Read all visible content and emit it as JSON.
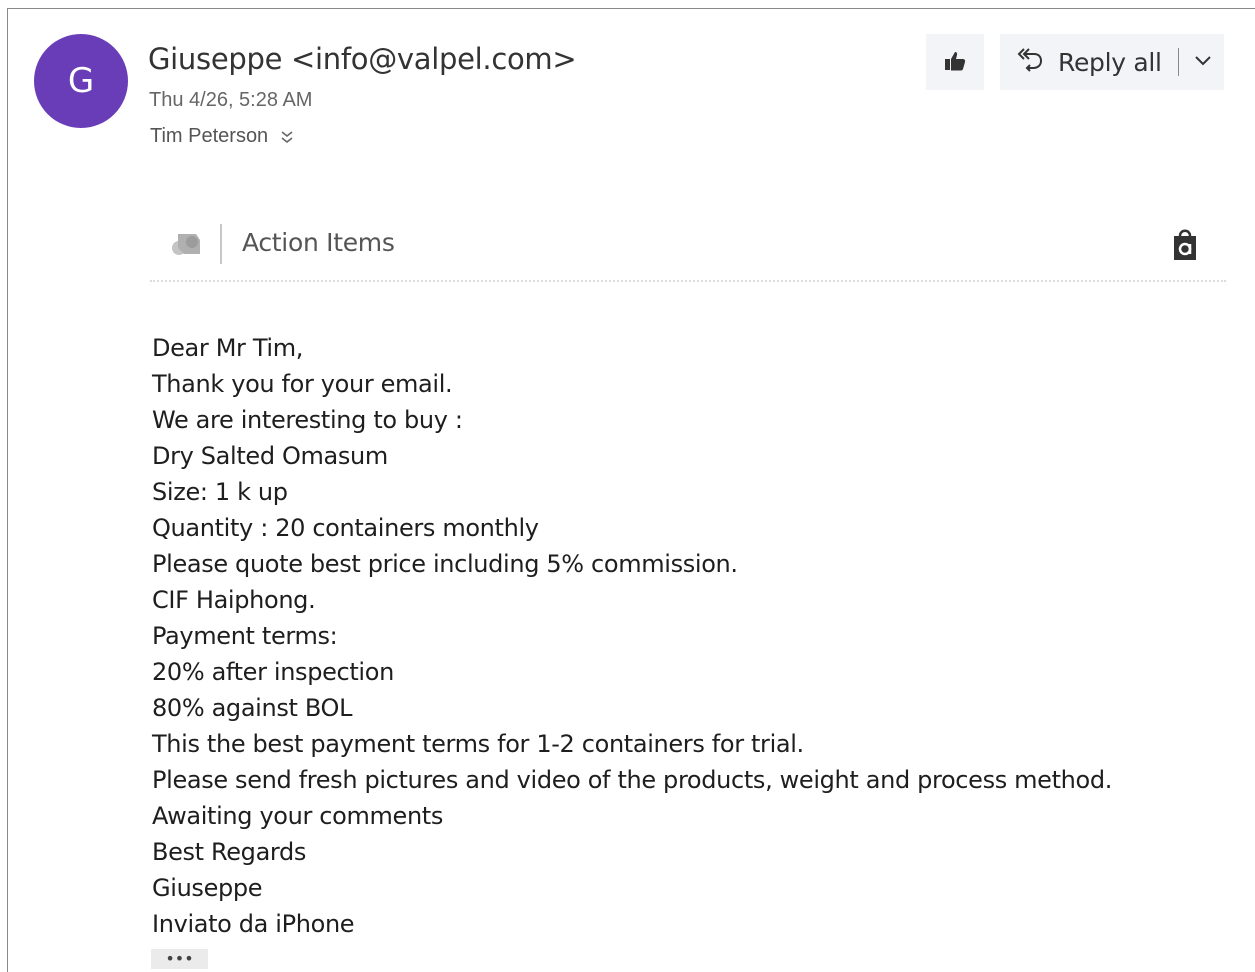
{
  "header": {
    "avatar_initial": "G",
    "avatar_color": "#6a3db8",
    "sender": "Giuseppe <info@valpel.com>",
    "date": "Thu 4/26, 5:28 AM",
    "recipient": "Tim Peterson"
  },
  "toolbar": {
    "like_icon": "thumbs-up-icon",
    "reply_icon": "reply-all-icon",
    "reply_all_label": "Reply all",
    "dropdown_icon": "chevron-down-icon"
  },
  "addin": {
    "icon": "addin-icon",
    "label": "Action Items",
    "store_icon": "store-bag-icon"
  },
  "body": {
    "lines": [
      "Dear Mr Tim,",
      "Thank you for your email.",
      "We are interesting to buy :",
      "Dry Salted Omasum",
      "Size: 1 k up",
      "Quantity : 20 containers monthly",
      "Please quote best price including 5% commission.",
      "CIF Haiphong.",
      "Payment terms:",
      "20% after inspection",
      "80% against BOL",
      "This the best payment terms for 1-2 containers for trial.",
      "Please send fresh pictures and video of the products, weight and process method.",
      "Awaiting your comments",
      "Best Regards",
      "Giuseppe",
      "Inviato da iPhone"
    ]
  },
  "more": {
    "label": "•••"
  }
}
